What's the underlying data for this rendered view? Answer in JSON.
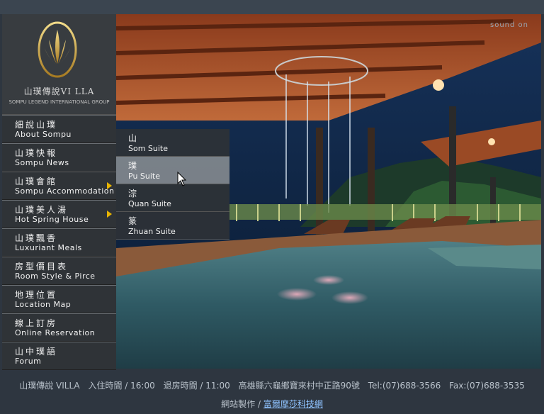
{
  "logo": {
    "title": "山璞傳說VI LLA",
    "subtitle": "SOMPU LEGEND INTERNATIONAL GROUP"
  },
  "sound_label": "sound on",
  "menu": [
    {
      "zh": "細說山璞",
      "en": "About  Sompu",
      "has_sub": false
    },
    {
      "zh": "山璞快報",
      "en": "Sompu News",
      "has_sub": false
    },
    {
      "zh": "山璞會館",
      "en": "Sompu Accommodation",
      "has_sub": true
    },
    {
      "zh": "山璞美人湯",
      "en": "Hot Spring House",
      "has_sub": true
    },
    {
      "zh": "山璞飄香",
      "en": "Luxuriant Meals",
      "has_sub": false
    },
    {
      "zh": "房型價目表",
      "en": "Room Style & Pirce",
      "has_sub": false
    },
    {
      "zh": "地理位置",
      "en": "Location Map",
      "has_sub": false
    },
    {
      "zh": "線上訂房",
      "en": "Online Reservation",
      "has_sub": false
    },
    {
      "zh": "山中璞語",
      "en": "Forum",
      "has_sub": false
    }
  ],
  "submenu": [
    {
      "zh": "山",
      "en": "Som Suite"
    },
    {
      "zh": "璞",
      "en": "Pu Suite"
    },
    {
      "zh": "淙",
      "en": "Quan Suite"
    },
    {
      "zh": "篆",
      "en": "Zhuan Suite"
    }
  ],
  "active_submenu_index": 1,
  "footer": {
    "name": "山璞傳說 VILLA",
    "checkin": "入住時間 / 16:00",
    "checkout": "退房時間 / 11:00",
    "address": "高雄縣六龜鄉寶來村中正路90號",
    "tel": "Tel:(07)688-3566",
    "fax": "Fax:(07)688-3535",
    "credit_label": "網站製作 / ",
    "credit_link": "富爾摩莎科技網"
  },
  "colors": {
    "accent": "#e8b400",
    "link": "#8fc3ff",
    "background": "#2e3640"
  }
}
